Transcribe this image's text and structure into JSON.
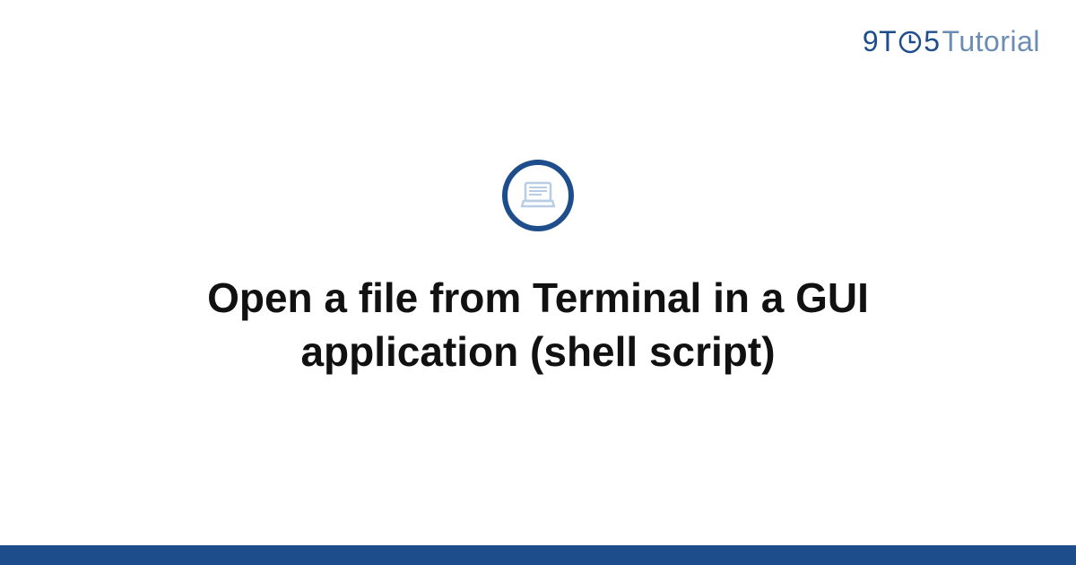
{
  "logo": {
    "prefix": "9T",
    "suffix": "5",
    "word": "Tutorial",
    "icon": "clock-icon"
  },
  "main": {
    "icon": "laptop-icon",
    "title": "Open a file from Terminal in a GUI application (shell script)"
  },
  "colors": {
    "brand": "#1e4d8b",
    "brandLight": "#6b8db5",
    "iconLight": "#b8cde4"
  }
}
